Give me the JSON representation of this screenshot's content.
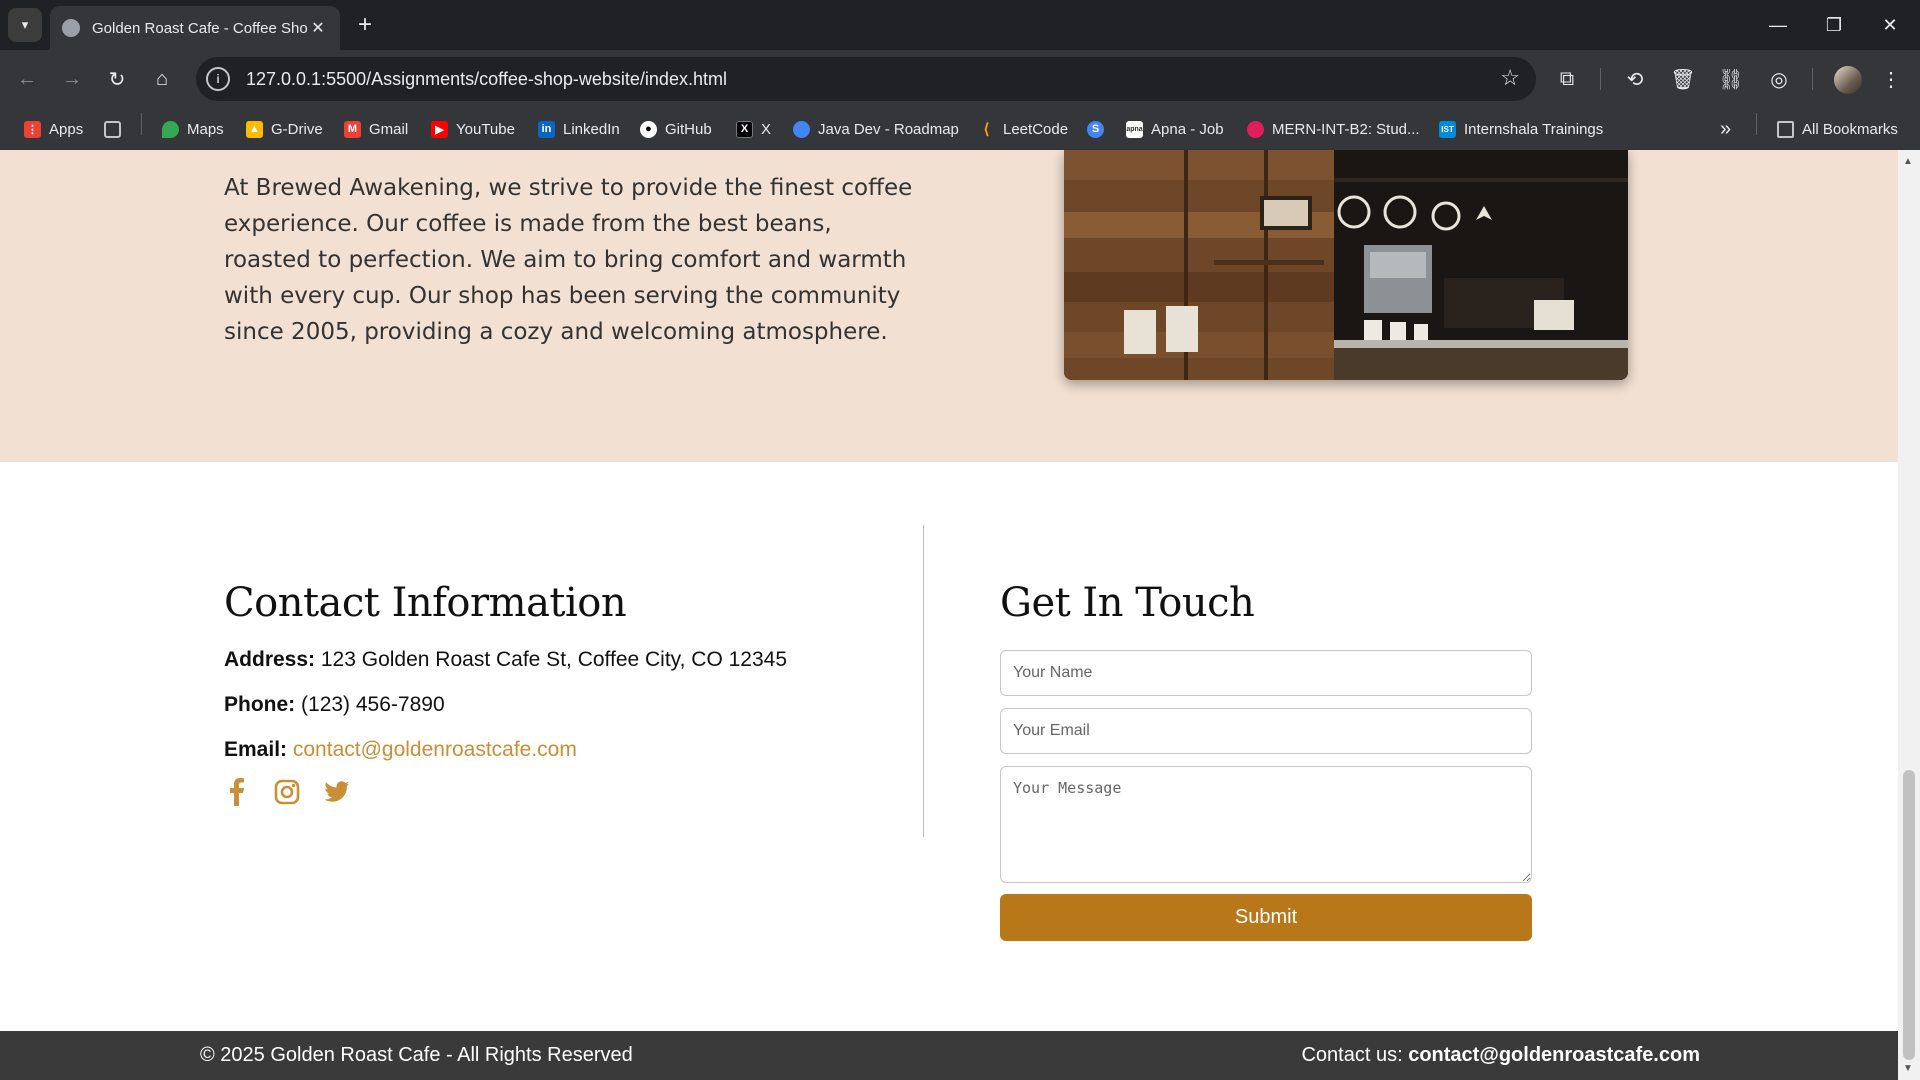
{
  "browser": {
    "tab_title": "Golden Roast Cafe - Coffee Shop",
    "tab_close": "✕",
    "new_tab": "+",
    "url": "127.0.0.1:5500/Assignments/coffee-shop-website/index.html",
    "bookmarks": [
      {
        "label": "Apps",
        "icon": "apps-grid-icon",
        "color": "#ea4335"
      },
      {
        "label": "Maps",
        "icon": "maps-pin-icon",
        "color": "#34a853"
      },
      {
        "label": "G-Drive",
        "icon": "drive-icon",
        "color": "#fbbc04"
      },
      {
        "label": "Gmail",
        "icon": "gmail-icon",
        "color": "#ea4335"
      },
      {
        "label": "YouTube",
        "icon": "youtube-icon",
        "color": "#ff0000"
      },
      {
        "label": "LinkedIn",
        "icon": "linkedin-icon",
        "color": "#0a66c2"
      },
      {
        "label": "GitHub",
        "icon": "github-icon",
        "color": "#ffffff"
      },
      {
        "label": "X",
        "icon": "x-icon",
        "color": "#000000"
      },
      {
        "label": "Java Dev - Roadmap",
        "icon": "chat-bubble-icon",
        "color": "#4285f4"
      },
      {
        "label": "LeetCode",
        "icon": "leetcode-icon",
        "color": "#ffa116"
      },
      {
        "label": "Apna - Job",
        "icon": "apna-icon",
        "color": "#ffffff"
      },
      {
        "label": "MERN-INT-B2: Stud...",
        "icon": "slack-icon",
        "color": "#e01e5a"
      },
      {
        "label": "Internshala Trainings",
        "icon": "internshala-icon",
        "color": "#008bdc"
      }
    ],
    "all_bookmarks": "All Bookmarks",
    "more_bookmarks": "»"
  },
  "about": {
    "paragraph": "At Brewed Awakening, we strive to provide the finest coffee experience. Our coffee is made from the best beans, roasted to perfection. We aim to bring comfort and warmth with every cup. Our shop has been serving the community since 2005, providing a cozy and welcoming atmosphere."
  },
  "contact": {
    "heading": "Contact Information",
    "address_label": "Address:",
    "address_value": "123 Golden Roast Cafe St, Coffee City, CO 12345",
    "phone_label": "Phone:",
    "phone_value": "(123) 456-7890",
    "email_label": "Email:",
    "email_value": "contact@goldenroastcafe.com",
    "socials": [
      "facebook-icon",
      "instagram-icon",
      "twitter-icon"
    ]
  },
  "form": {
    "heading": "Get In Touch",
    "name_placeholder": "Your Name",
    "email_placeholder": "Your Email",
    "message_placeholder": "Your Message",
    "submit_label": "Submit"
  },
  "footer": {
    "copyright": "© 2025 Golden Roast Cafe - All Rights Reserved",
    "contact_prefix": "Contact us:",
    "contact_email": "contact@goldenroastcafe.com"
  },
  "colors": {
    "accent": "#c98f36",
    "button": "#b87819",
    "about_bg": "#f2e0d2",
    "footer_bg": "#3a3a3a"
  }
}
